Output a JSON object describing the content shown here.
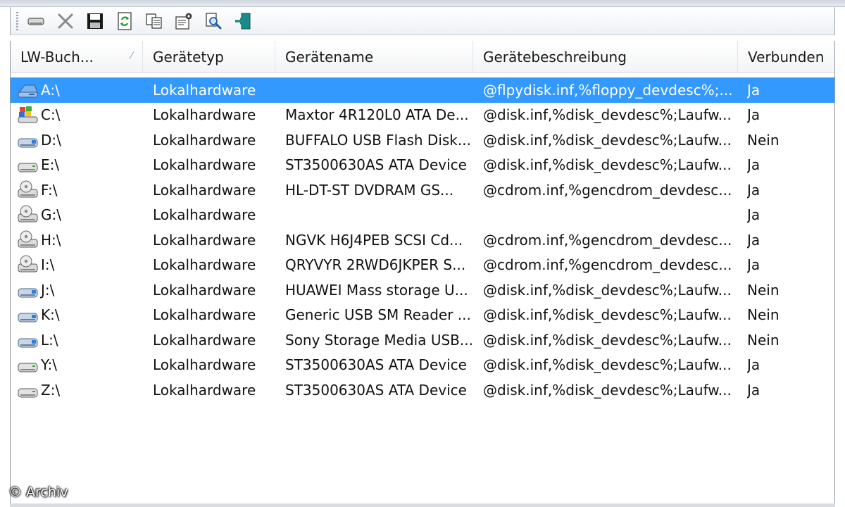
{
  "toolbar": {
    "buttons": [
      {
        "icon": "drive-icon",
        "label": ""
      },
      {
        "icon": "delete-icon",
        "label": ""
      },
      {
        "icon": "save-icon",
        "label": ""
      },
      {
        "icon": "refresh-icon",
        "label": ""
      },
      {
        "icon": "copy-icon",
        "label": ""
      },
      {
        "icon": "properties-icon",
        "label": ""
      },
      {
        "icon": "find-icon",
        "label": ""
      },
      {
        "icon": "exit-icon",
        "label": ""
      }
    ]
  },
  "columns": [
    {
      "label": "LW-Buch..."
    },
    {
      "label": "Gerätetyp"
    },
    {
      "label": "Gerätename"
    },
    {
      "label": "Gerätebeschreibung"
    },
    {
      "label": "Verbunden"
    }
  ],
  "rows": [
    {
      "drive": "A:\\",
      "type": "Lokalhardware",
      "name": "",
      "desc": "@flpydisk.inf,%floppy_devdesc%;...",
      "connected": "Ja",
      "icon": "floppy"
    },
    {
      "drive": "C:\\",
      "type": "Lokalhardware",
      "name": "Maxtor 4R120L0 ATA De...",
      "desc": "@disk.inf,%disk_devdesc%;Laufw...",
      "connected": "Ja",
      "icon": "system"
    },
    {
      "drive": "D:\\",
      "type": "Lokalhardware",
      "name": "BUFFALO USB Flash Disk...",
      "desc": "@disk.inf,%disk_devdesc%;Laufw...",
      "connected": "Nein",
      "icon": "usb"
    },
    {
      "drive": "E:\\",
      "type": "Lokalhardware",
      "name": "ST3500630AS ATA Device",
      "desc": "@disk.inf,%disk_devdesc%;Laufw...",
      "connected": "Ja",
      "icon": "hdd"
    },
    {
      "drive": "F:\\",
      "type": "Lokalhardware",
      "name": "HL-DT-ST DVDRAM GS...",
      "desc": "@cdrom.inf,%gencdrom_devdesc...",
      "connected": "Ja",
      "icon": "cdrom"
    },
    {
      "drive": "G:\\",
      "type": "Lokalhardware",
      "name": "",
      "desc": "",
      "connected": "Ja",
      "icon": "cdrom"
    },
    {
      "drive": "H:\\",
      "type": "Lokalhardware",
      "name": "NGVK H6J4PEB SCSI Cd...",
      "desc": "@cdrom.inf,%gencdrom_devdesc...",
      "connected": "Ja",
      "icon": "cdrom"
    },
    {
      "drive": "I:\\",
      "type": "Lokalhardware",
      "name": "QRYVYR 2RWD6JKPER S...",
      "desc": "@cdrom.inf,%gencdrom_devdesc...",
      "connected": "Ja",
      "icon": "cdrom"
    },
    {
      "drive": "J:\\",
      "type": "Lokalhardware",
      "name": "HUAWEI Mass storage U...",
      "desc": "@disk.inf,%disk_devdesc%;Laufw...",
      "connected": "Nein",
      "icon": "usb"
    },
    {
      "drive": "K:\\",
      "type": "Lokalhardware",
      "name": "Generic USB SM Reader ...",
      "desc": "@disk.inf,%disk_devdesc%;Laufw...",
      "connected": "Nein",
      "icon": "usb"
    },
    {
      "drive": "L:\\",
      "type": "Lokalhardware",
      "name": "Sony Storage Media USB...",
      "desc": "@disk.inf,%disk_devdesc%;Laufw...",
      "connected": "Nein",
      "icon": "usb"
    },
    {
      "drive": "Y:\\",
      "type": "Lokalhardware",
      "name": "ST3500630AS ATA Device",
      "desc": "@disk.inf,%disk_devdesc%;Laufw...",
      "connected": "Ja",
      "icon": "hdd"
    },
    {
      "drive": "Z:\\",
      "type": "Lokalhardware",
      "name": "ST3500630AS ATA Device",
      "desc": "@disk.inf,%disk_devdesc%;Laufw...",
      "connected": "Ja",
      "icon": "hdd"
    }
  ],
  "selected_row": 0,
  "watermark": "© Archiv",
  "colors": {
    "selection": "#3399ff"
  }
}
